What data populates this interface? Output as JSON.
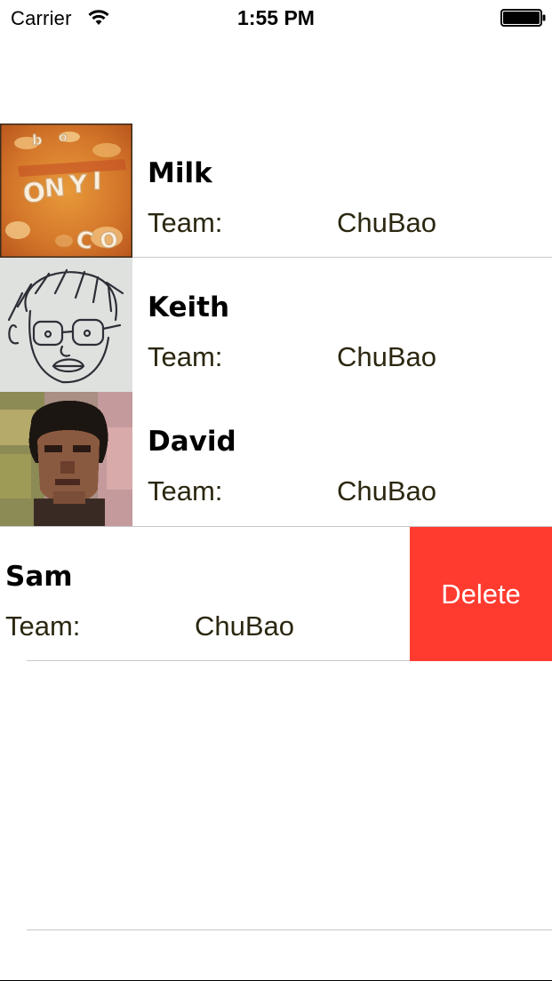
{
  "status_bar": {
    "carrier": "Carrier",
    "time": "1:55 PM",
    "wifi_icon": "wifi-icon",
    "battery_icon": "battery-full-icon"
  },
  "players": [
    {
      "name": "Milk",
      "team_label": "Team:",
      "team": "ChuBao",
      "avatar": "alphabet-soup-photo"
    },
    {
      "name": "Keith",
      "team_label": "Team:",
      "team": "ChuBao",
      "avatar": "cartoon-face-drawing"
    },
    {
      "name": "David",
      "team_label": "Team:",
      "team": "ChuBao",
      "avatar": "portrait-photo"
    },
    {
      "name": "Sam",
      "team_label": "Team:",
      "team": "ChuBao",
      "avatar": "none"
    }
  ],
  "swipe_action": {
    "delete_label": "Delete",
    "color": "#ff3b30"
  },
  "colors": {
    "team_text": "#2b2710",
    "separator": "#c8c7cc"
  }
}
